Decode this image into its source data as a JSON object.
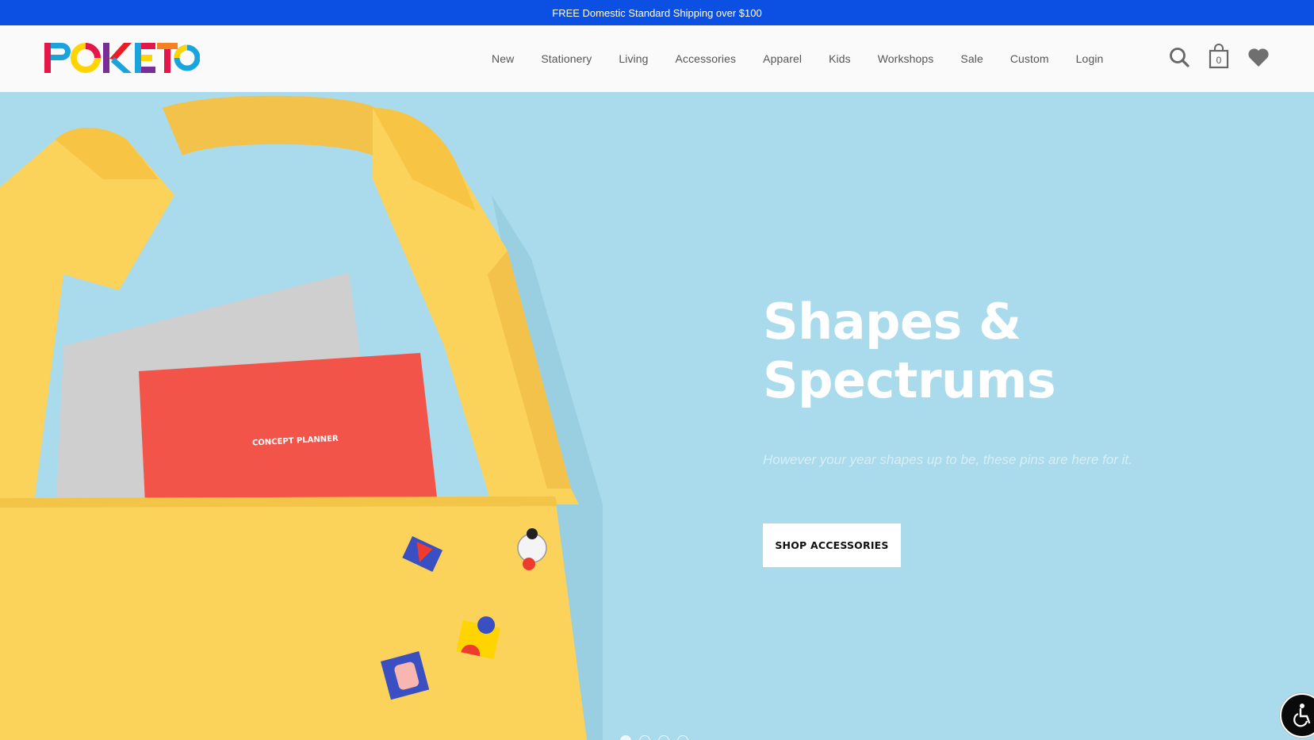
{
  "announcement": {
    "text": "FREE Domestic Standard Shipping over $100"
  },
  "brand": {
    "name": "POKETO",
    "logo_colors": [
      "#e5174a",
      "#19a4dc",
      "#ffd400",
      "#7a2d96",
      "#ed1c24",
      "#f58220"
    ]
  },
  "nav": {
    "items": [
      {
        "label": "New"
      },
      {
        "label": "Stationery"
      },
      {
        "label": "Living"
      },
      {
        "label": "Accessories"
      },
      {
        "label": "Apparel"
      },
      {
        "label": "Kids"
      },
      {
        "label": "Workshops"
      },
      {
        "label": "Sale"
      },
      {
        "label": "Custom"
      },
      {
        "label": "Login"
      }
    ]
  },
  "header_icons": {
    "search": "search-icon",
    "cart": "shopping-bag-icon",
    "cart_count": "0",
    "wishlist": "heart-icon"
  },
  "hero": {
    "title_line1": "Shapes &",
    "title_line2": "Spectrums",
    "subtitle": "However your year shapes up to be, these pins are here for it.",
    "cta_label": "SHOP ACCESSORIES",
    "planner_label": "CONCEPT PLANNER",
    "background_color": "#a9dbec",
    "slide_count": 4,
    "active_slide": 1
  },
  "accessibility": {
    "icon": "accessibility-icon"
  },
  "colors": {
    "announcement_bg": "#0b50e3",
    "tote_yellow": "#fbd25a",
    "planner_red": "#f3544a"
  }
}
